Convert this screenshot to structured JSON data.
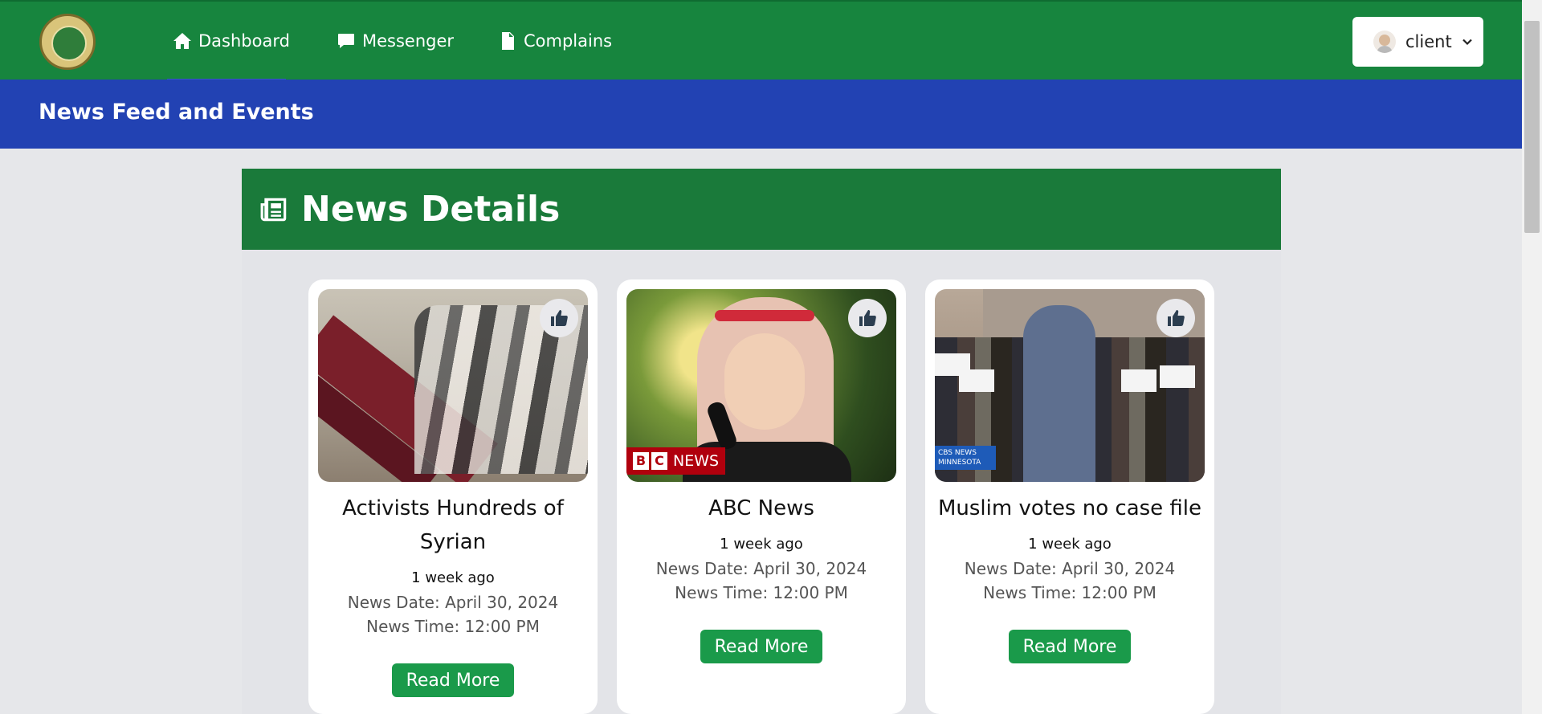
{
  "nav": {
    "items": [
      {
        "label": "Dashboard",
        "icon": "home-icon"
      },
      {
        "label": "Messenger",
        "icon": "chat-icon"
      },
      {
        "label": "Complains",
        "icon": "document-icon"
      }
    ],
    "user": {
      "label": "client",
      "icon": "user-avatar"
    }
  },
  "banner": {
    "title": "News Feed and Events"
  },
  "panel": {
    "title": "News Details",
    "icon": "newspaper-icon"
  },
  "cards": [
    {
      "title": "Activists Hundreds of Syrian",
      "ago": "1 week ago",
      "date": "News Date: April 30, 2024",
      "time": "News Time: 12:00 PM",
      "button": "Read More"
    },
    {
      "title": "ABC News",
      "ago": "1 week ago",
      "date": "News Date: April 30, 2024",
      "time": "News Time: 12:00 PM",
      "button": "Read More",
      "image_tag": "BBC NEWS"
    },
    {
      "title": "Muslim votes no case file",
      "ago": "1 week ago",
      "date": "News Date: April 30, 2024",
      "time": "News Time: 12:00 PM",
      "button": "Read More",
      "image_tag": "CBS NEWS MINNESOTA"
    }
  ],
  "colors": {
    "topbar": "#17853e",
    "banner": "#2242b3",
    "panel_header": "#1a7a3a",
    "button": "#1a9a4a"
  }
}
